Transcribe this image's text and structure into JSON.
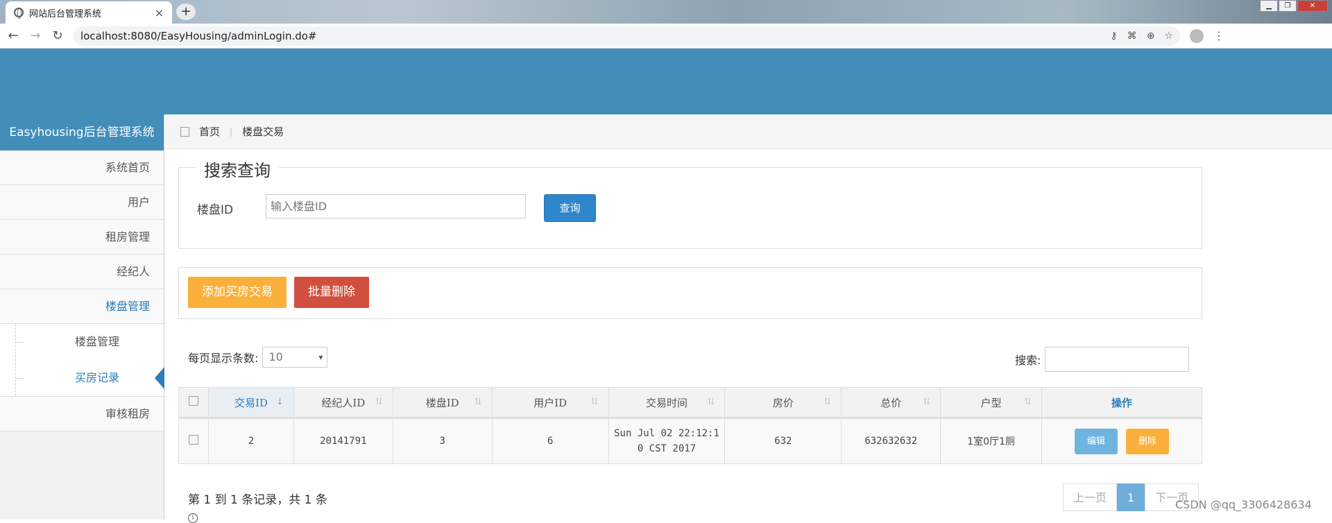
{
  "browser": {
    "tab_title": "网站后台管理系统",
    "tab_close": "×",
    "new_tab": "+",
    "url": "localhost:8080/EasyHousing/adminLogin.do#"
  },
  "sidebar": {
    "brand": "Easyhousing后台管理系统",
    "items": [
      {
        "label": "系统首页"
      },
      {
        "label": "用户"
      },
      {
        "label": "租房管理"
      },
      {
        "label": "经纪人"
      },
      {
        "label": "楼盘管理"
      }
    ],
    "subitems": [
      {
        "label": "楼盘管理"
      },
      {
        "label": "买房记录"
      }
    ],
    "last_item": "审核租房"
  },
  "breadcrumb": {
    "home": "首页",
    "current": "楼盘交易"
  },
  "search": {
    "legend": "搜索查询",
    "label": "楼盘ID",
    "placeholder": "输入楼盘ID",
    "button": "查询"
  },
  "actions": {
    "add": "添加买房交易",
    "batch_delete": "批量删除"
  },
  "table_controls": {
    "length_label": "每页显示条数:",
    "length_value": "10",
    "filter_label": "搜索:"
  },
  "table": {
    "headers": [
      "交易ID",
      "经纪人ID",
      "楼盘ID",
      "用户ID",
      "交易时间",
      "房价",
      "总价",
      "户型",
      "操作"
    ],
    "rows": [
      {
        "id": "2",
        "agent_id": "20141791",
        "building_id": "3",
        "user_id": "6",
        "time_line1": "Sun Jul 02 22:12:1",
        "time_line2": "0 CST 2017",
        "price": "632",
        "total": "632632632",
        "layout": "1室0厅1厕",
        "edit": "编辑",
        "delete": "删除"
      }
    ]
  },
  "footer": {
    "info": "第 1 到 1 条记录，共 1 条",
    "prev": "上一页",
    "page": "1",
    "next": "下一页"
  },
  "watermark": "CSDN @qq_3306428634",
  "colors": {
    "header_blue": "#438eb9",
    "link_blue": "#2b7dbc",
    "add_orange": "#fbb03b",
    "delete_red": "#d14f3f",
    "query_blue": "#2f86cb"
  }
}
